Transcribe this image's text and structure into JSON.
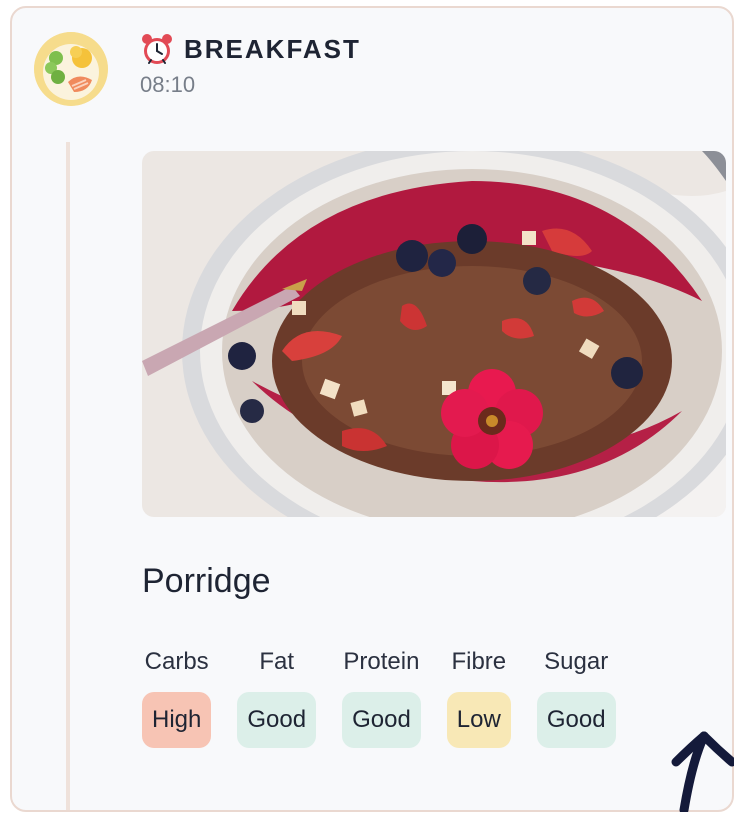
{
  "meal": {
    "title": "BREAKFAST",
    "time": "08:10",
    "icon": "alarm-clock-icon"
  },
  "food": {
    "name": "Porridge",
    "image_alt": "porridge-bowl-photo"
  },
  "nutrients": [
    {
      "label": "Carbs",
      "rating": "High",
      "color": "#f7c4b4"
    },
    {
      "label": "Fat",
      "rating": "Good",
      "color": "#dcefe9"
    },
    {
      "label": "Protein",
      "rating": "Good",
      "color": "#dcefe9"
    },
    {
      "label": "Fibre",
      "rating": "Low",
      "color": "#f8e8b6"
    },
    {
      "label": "Sugar",
      "rating": "Good",
      "color": "#dcefe9"
    }
  ],
  "colors": {
    "text_primary": "#1e2433",
    "text_muted": "#777e89",
    "card_border": "#ead8d0"
  }
}
